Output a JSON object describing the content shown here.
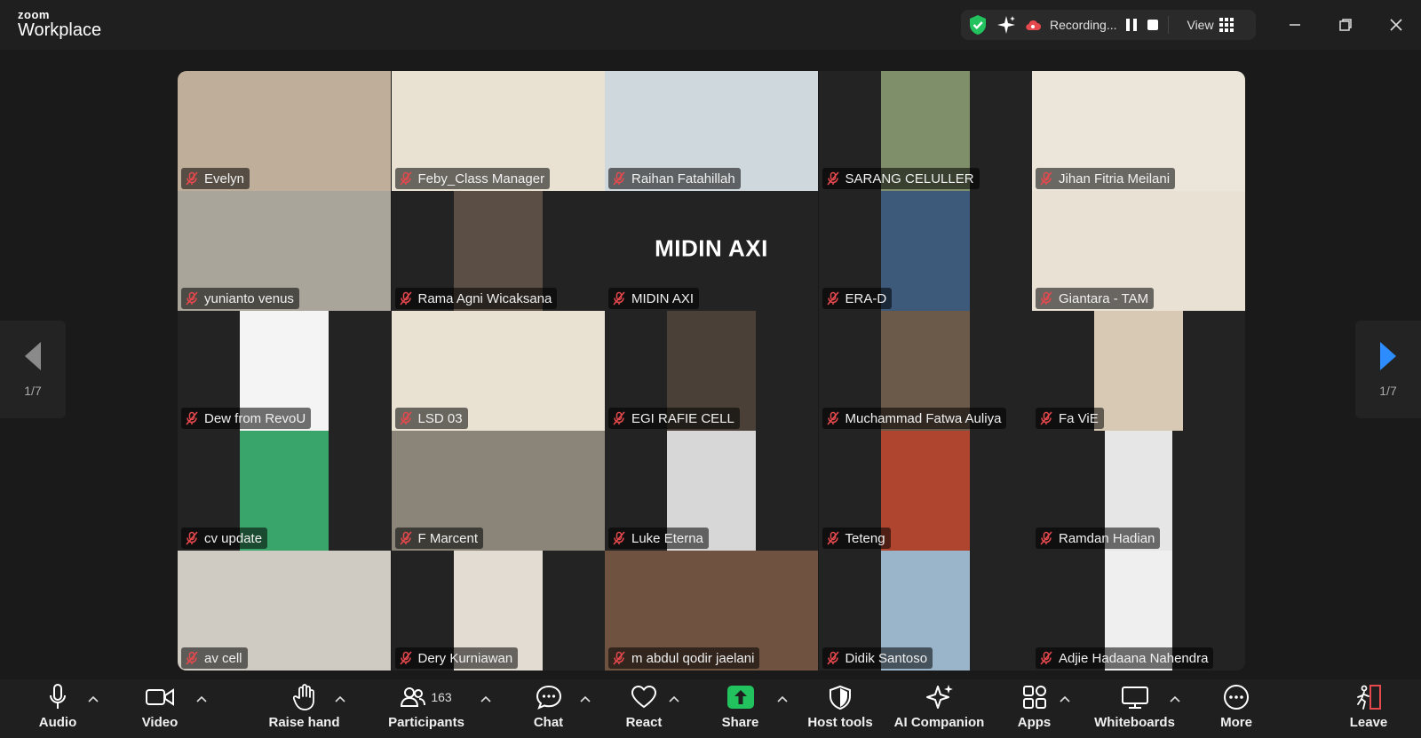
{
  "app": {
    "brand_small": "zoom",
    "brand_big": "Workplace"
  },
  "status_bar": {
    "recording_text": "Recording...",
    "view_label": "View"
  },
  "pager": {
    "left": "1/7",
    "right": "1/7"
  },
  "tiles": [
    {
      "name": "Evelyn",
      "bg": "#bfae9a",
      "width": 240,
      "active": false
    },
    {
      "name": "Feby_Class Manager",
      "bg": "#e9e2d3",
      "width": 240,
      "active": false
    },
    {
      "name": "Raihan Fatahillah",
      "bg": "#cfd8dc",
      "width": 240,
      "active": false
    },
    {
      "name": "SARANG CELULLER",
      "bg": "#7f8f6a",
      "width": 100,
      "active": false
    },
    {
      "name": "Jihan Fitria Meilani",
      "bg": "#ece6da",
      "width": 240,
      "active": false
    },
    {
      "name": "yunianto venus",
      "bg": "#a9a59a",
      "width": 240,
      "active": false
    },
    {
      "name": "Rama Agni Wicaksana",
      "bg": "#5a4e45",
      "width": 100,
      "active": false
    },
    {
      "name": "MIDIN AXI",
      "bg": "#232323",
      "width": 0,
      "active": false,
      "big_text": "MIDIN AXI"
    },
    {
      "name": "ERA-D",
      "bg": "#3d5a7a",
      "width": 100,
      "active": false
    },
    {
      "name": "Giantara - TAM",
      "bg": "#e8e1d4",
      "width": 240,
      "active": true
    },
    {
      "name": "Dew from RevoU",
      "bg": "#f4f4f4",
      "width": 100,
      "active": false
    },
    {
      "name": "LSD 03",
      "bg": "#e9e2d3",
      "width": 240,
      "active": false
    },
    {
      "name": "EGI RAFIE CELL",
      "bg": "#4a4038",
      "width": 100,
      "active": false
    },
    {
      "name": "Muchammad Fatwa Auliya",
      "bg": "#6b5a4a",
      "width": 100,
      "active": false
    },
    {
      "name": "Fa ViE",
      "bg": "#d8c9b5",
      "width": 100,
      "active": false
    },
    {
      "name": "cv update",
      "bg": "#3aa56a",
      "width": 100,
      "active": false
    },
    {
      "name": "F Marcent",
      "bg": "#8a8578",
      "width": 240,
      "active": false
    },
    {
      "name": "Luke Eterna",
      "bg": "#d7d7d7",
      "width": 100,
      "active": false
    },
    {
      "name": "Teteng",
      "bg": "#b0452f",
      "width": 100,
      "active": false
    },
    {
      "name": "Ramdan Hadian",
      "bg": "#e6e6e6",
      "width": 76,
      "active": false
    },
    {
      "name": "av cell",
      "bg": "#cfcac2",
      "width": 240,
      "active": false
    },
    {
      "name": "Dery Kurniawan",
      "bg": "#e2dcd2",
      "width": 100,
      "active": false
    },
    {
      "name": "m abdul qodir jaelani",
      "bg": "#6f5340",
      "width": 240,
      "active": false
    },
    {
      "name": "Didik Santoso",
      "bg": "#9ab5c9",
      "width": 100,
      "active": false
    },
    {
      "name": "Adjie Hadaana Nahendra",
      "bg": "#efefef",
      "width": 76,
      "active": false
    }
  ],
  "toolbar": {
    "audio": "Audio",
    "video": "Video",
    "raise_hand": "Raise hand",
    "participants": "Participants",
    "participants_count": "163",
    "chat": "Chat",
    "react": "React",
    "share": "Share",
    "host_tools": "Host tools",
    "ai_companion": "AI Companion",
    "apps": "Apps",
    "whiteboards": "Whiteboards",
    "more": "More",
    "leave": "Leave"
  },
  "colors": {
    "accent_green": "#3fd08a",
    "share_green": "#22c35e",
    "leave_red": "#e5484d",
    "muted_red": "#e5484d"
  }
}
